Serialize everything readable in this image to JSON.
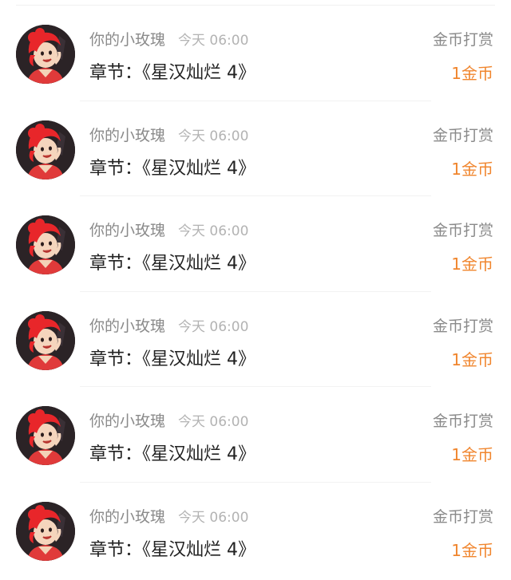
{
  "rewards": [
    {
      "user": "你的小玫瑰",
      "time": "今天 06:00",
      "chapter_prefix": "章节：",
      "chapter_title": "《星汉灿烂 4》",
      "type_label": "金币打赏",
      "amount": "1金币",
      "avatar_icon": "cartoon-girl-avatar"
    },
    {
      "user": "你的小玫瑰",
      "time": "今天 06:00",
      "chapter_prefix": "章节：",
      "chapter_title": "《星汉灿烂 4》",
      "type_label": "金币打赏",
      "amount": "1金币",
      "avatar_icon": "cartoon-girl-avatar"
    },
    {
      "user": "你的小玫瑰",
      "time": "今天 06:00",
      "chapter_prefix": "章节：",
      "chapter_title": "《星汉灿烂 4》",
      "type_label": "金币打赏",
      "amount": "1金币",
      "avatar_icon": "cartoon-girl-avatar"
    },
    {
      "user": "你的小玫瑰",
      "time": "今天 06:00",
      "chapter_prefix": "章节：",
      "chapter_title": "《星汉灿烂 4》",
      "type_label": "金币打赏",
      "amount": "1金币",
      "avatar_icon": "cartoon-girl-avatar"
    },
    {
      "user": "你的小玫瑰",
      "time": "今天 06:00",
      "chapter_prefix": "章节：",
      "chapter_title": "《星汉灿烂 4》",
      "type_label": "金币打赏",
      "amount": "1金币",
      "avatar_icon": "cartoon-girl-avatar"
    },
    {
      "user": "你的小玫瑰",
      "time": "今天 06:00",
      "chapter_prefix": "章节：",
      "chapter_title": "《星汉灿烂 4》",
      "type_label": "金币打赏",
      "amount": "1金币",
      "avatar_icon": "cartoon-girl-avatar"
    }
  ],
  "colors": {
    "accent_amount": "#f0852d",
    "secondary_text": "#8a8a8a",
    "primary_text": "#222222"
  }
}
